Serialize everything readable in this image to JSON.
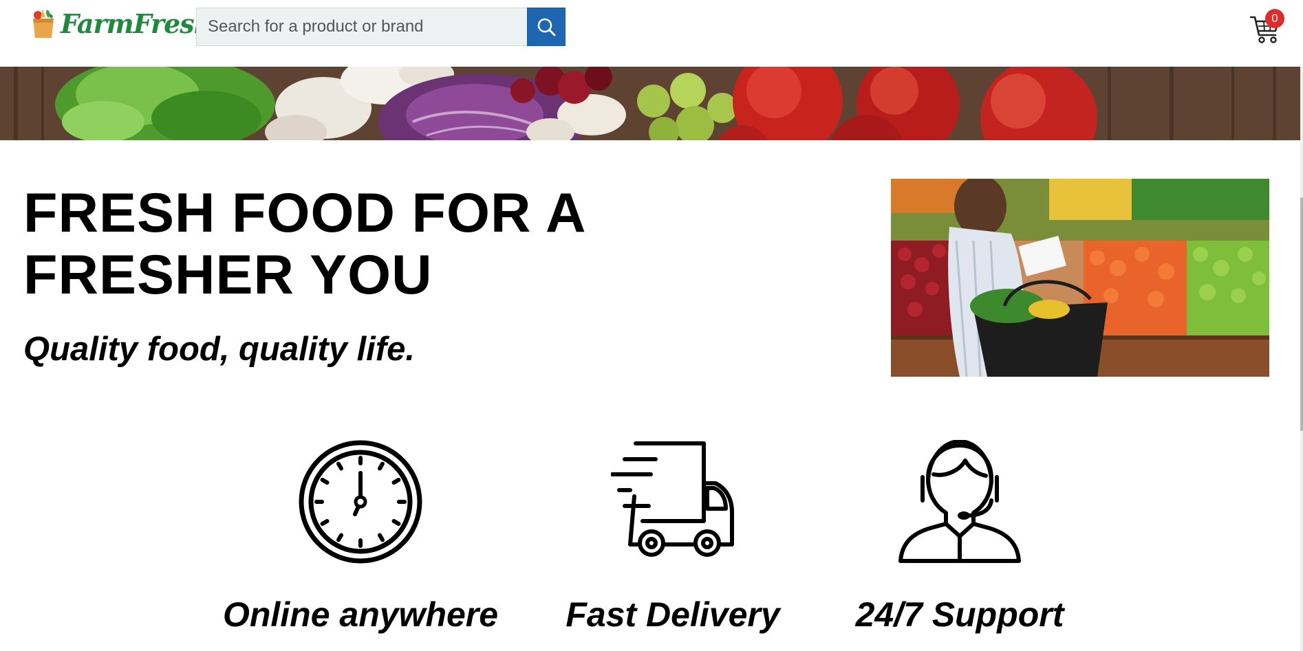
{
  "header": {
    "logo_text": "FarmFresh",
    "search_placeholder": "Search for a product or brand",
    "cart_count": "0"
  },
  "colors": {
    "brand_green": "#1f8a3b",
    "search_button": "#1f66b2",
    "cart_badge": "#e02b2b"
  },
  "hero": {
    "title": "FRESH FOOD FOR A FRESHER YOU",
    "subtitle": "Quality food, quality life."
  },
  "features": [
    {
      "icon": "clock-icon",
      "label": "Online anywhere"
    },
    {
      "icon": "delivery-truck-icon",
      "label": "Fast Delivery"
    },
    {
      "icon": "support-agent-icon",
      "label": "24/7 Support"
    }
  ]
}
